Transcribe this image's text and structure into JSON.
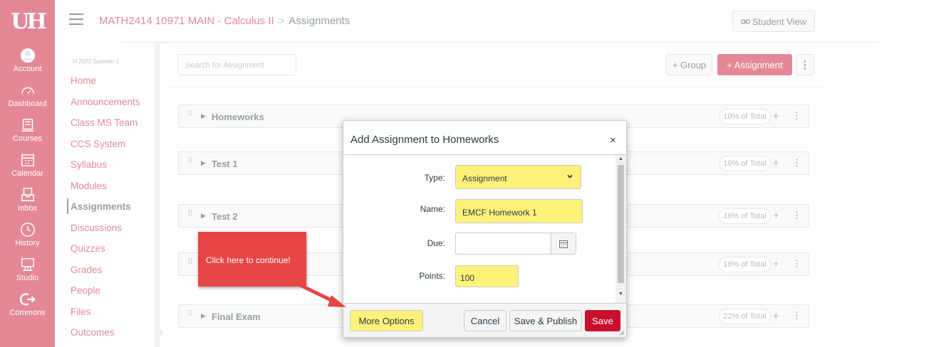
{
  "nav": {
    "logo": "UH",
    "items": [
      {
        "label": "Account",
        "icon": "account-icon"
      },
      {
        "label": "Dashboard",
        "icon": "dashboard-icon"
      },
      {
        "label": "Courses",
        "icon": "courses-icon"
      },
      {
        "label": "Calendar",
        "icon": "calendar-icon"
      },
      {
        "label": "Inbox",
        "icon": "inbox-icon"
      },
      {
        "label": "History",
        "icon": "history-icon"
      },
      {
        "label": "Studio",
        "icon": "studio-icon"
      },
      {
        "label": "Commons",
        "icon": "commons-icon"
      }
    ]
  },
  "header": {
    "course": "MATH2414 10971 MAIN - Calculus II",
    "separator": ">",
    "current": "Assignments",
    "student_view": "Student View"
  },
  "course_nav": {
    "term": "H 2023 Summer 1",
    "items": [
      "Home",
      "Announcements",
      "Class MS Team",
      "CCS System",
      "Syllabus",
      "Modules",
      "Assignments",
      "Discussions",
      "Quizzes",
      "Grades",
      "People",
      "Files",
      "Outcomes"
    ],
    "active_index": 6
  },
  "toolbar": {
    "search_placeholder": "Search for Assignment",
    "group_label": "+ Group",
    "assignment_label": "+ Assignment",
    "kebab": "⋮"
  },
  "groups": [
    {
      "name": "Homeworks",
      "weight": "10% of Total"
    },
    {
      "name": "Test 1",
      "weight": "16% of Total"
    },
    {
      "name": "Test 2",
      "weight": "16% of Total"
    },
    {
      "name": "",
      "weight": "16% of Total"
    },
    {
      "name": "Final Exam",
      "weight": "22% of Total"
    }
  ],
  "dialog": {
    "title": "Add Assignment to Homeworks",
    "close": "×",
    "type_label": "Type:",
    "type_value": "Assignment",
    "name_label": "Name:",
    "name_value": "EMCF Homework 1",
    "due_label": "Due:",
    "due_value": "",
    "points_label": "Points:",
    "points_value": "100",
    "more_options": "More Options",
    "cancel": "Cancel",
    "save_publish": "Save & Publish",
    "save": "Save"
  },
  "callout": {
    "text": "Click here to continue!"
  },
  "colors": {
    "brand": "#c8102e",
    "highlight": "#fff27a",
    "callout": "#e64646"
  }
}
